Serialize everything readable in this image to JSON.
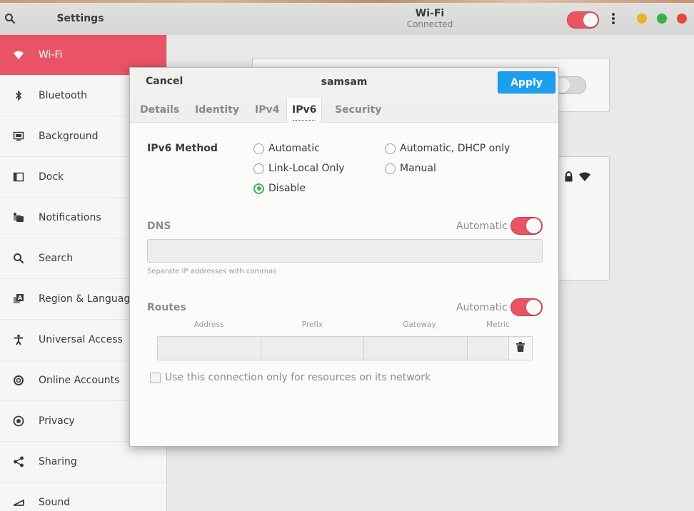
{
  "header": {
    "left_title": "Settings",
    "center_title": "Wi-Fi",
    "center_subtitle": "Connected",
    "wifi_switch_on": true,
    "icons": [
      "search-icon",
      "menu-dots-icon"
    ],
    "window_buttons": [
      "minimize",
      "maximize",
      "close"
    ]
  },
  "sidebar": {
    "items": [
      {
        "label": "Wi-Fi",
        "icon": "wifi-icon",
        "active": true
      },
      {
        "label": "Bluetooth",
        "icon": "bluetooth-icon"
      },
      {
        "label": "Background",
        "icon": "background-icon"
      },
      {
        "label": "Dock",
        "icon": "dock-icon"
      },
      {
        "label": "Notifications",
        "icon": "notifications-icon"
      },
      {
        "label": "Search",
        "icon": "search-icon"
      },
      {
        "label": "Region & Language",
        "icon": "region-icon"
      },
      {
        "label": "Universal Access",
        "icon": "universal-access-icon"
      },
      {
        "label": "Online Accounts",
        "icon": "online-accounts-icon"
      },
      {
        "label": "Privacy",
        "icon": "privacy-icon"
      },
      {
        "label": "Sharing",
        "icon": "sharing-icon"
      },
      {
        "label": "Sound",
        "icon": "sound-icon"
      }
    ]
  },
  "dialog": {
    "cancel_label": "Cancel",
    "title": "samsam",
    "apply_label": "Apply",
    "tabs": [
      {
        "label": "Details"
      },
      {
        "label": "Identity"
      },
      {
        "label": "IPv4"
      },
      {
        "label": "IPv6",
        "active": true
      },
      {
        "label": "Security"
      }
    ],
    "ipv6_method": {
      "label": "IPv6 Method",
      "options": [
        {
          "label": "Automatic",
          "checked": false
        },
        {
          "label": "Automatic, DHCP only",
          "checked": false
        },
        {
          "label": "Link-Local Only",
          "checked": false
        },
        {
          "label": "Manual",
          "checked": false
        },
        {
          "label": "Disable",
          "checked": true
        }
      ]
    },
    "dns": {
      "label": "DNS",
      "automatic_label": "Automatic",
      "automatic_on": true,
      "value": "",
      "hint": "Separate IP addresses with commas"
    },
    "routes": {
      "label": "Routes",
      "automatic_label": "Automatic",
      "automatic_on": true,
      "columns": [
        "Address",
        "Prefix",
        "Gateway",
        "Metric"
      ],
      "rows": [
        {
          "address": "",
          "prefix": "",
          "gateway": "",
          "metric": ""
        }
      ]
    },
    "only_local_label": "Use this connection only for resources on its network",
    "only_local_checked": false
  },
  "colors": {
    "accent_red": "#e95464",
    "apply_blue": "#1d9ff0",
    "radio_green": "#3eb34f"
  }
}
